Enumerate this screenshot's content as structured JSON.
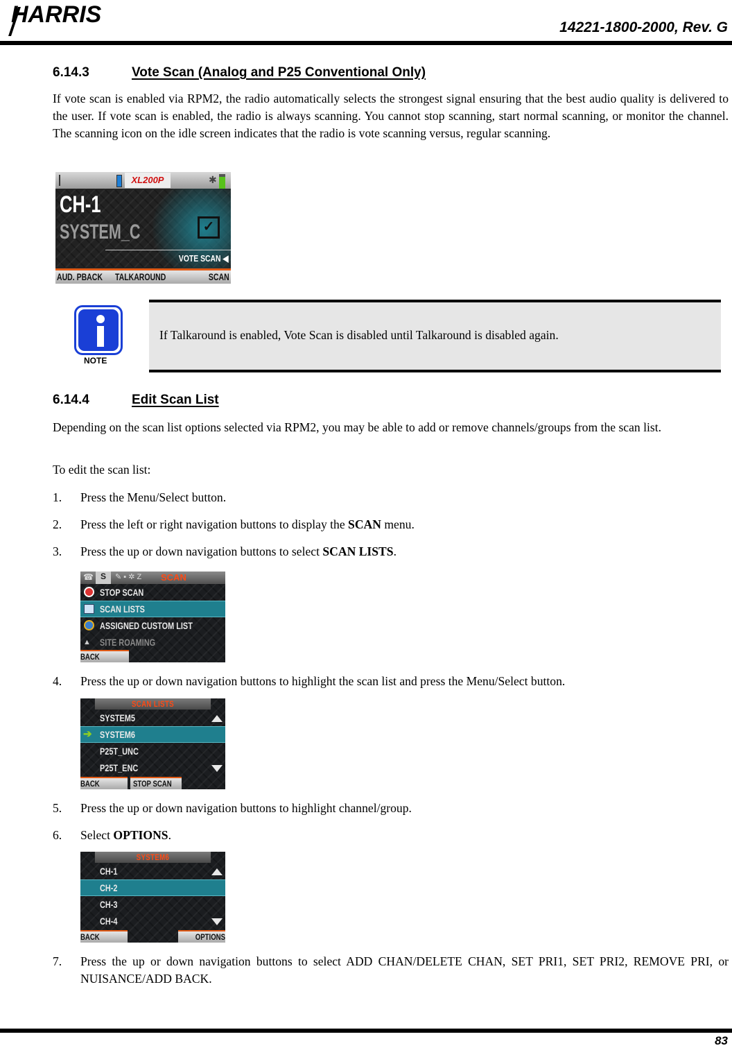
{
  "header": {
    "logo_text": "HARRIS",
    "doc_number": "14221-1800-2000, Rev. G"
  },
  "section_1": {
    "number": "6.14.3",
    "title": "Vote Scan (Analog and P25 Conventional Only)",
    "paragraph": "If vote scan is enabled via RPM2, the radio automatically selects the strongest signal ensuring that the best audio quality is delivered to the user. If vote scan is enabled, the radio is always scanning. You cannot stop scanning, start normal scanning, or monitor the channel. The scanning icon on the idle screen indicates that the radio is vote scanning versus, regular scanning.",
    "screen": {
      "brand": "XL200P",
      "channel": "CH-1",
      "system": "SYSTEM_C",
      "status": "VOTE SCAN",
      "softkeys": [
        "AUD. PBACK",
        "TALKAROUND",
        "SCAN"
      ],
      "colors": {
        "accent": "#e05a16",
        "teal": "#1f7f8e",
        "battery": "#57c21b"
      }
    }
  },
  "note": {
    "label": "NOTE",
    "text": "If Talkaround is enabled, Vote Scan is disabled until Talkaround is disabled again."
  },
  "section_2": {
    "number": "6.14.4",
    "title": "Edit Scan List",
    "paragraph": "Depending on the scan list options selected via RPM2, you may be able to add or remove channels/groups from the scan list.",
    "intro": "To edit the scan list:",
    "steps": [
      {
        "n": "1.",
        "text": "Press the Menu/Select button."
      },
      {
        "n": "2.",
        "pre": "Press the left or right navigation buttons to display the ",
        "bold": "SCAN",
        "post": " menu."
      },
      {
        "n": "3.",
        "pre": "Press the up or down navigation buttons to select ",
        "bold": "SCAN LISTS",
        "post": "."
      },
      {
        "n": "4.",
        "text": "Press the up or down navigation buttons to highlight the scan list and press the Menu/Select button."
      },
      {
        "n": "5.",
        "text": "Press the up or down navigation buttons to highlight channel/group."
      },
      {
        "n": "6.",
        "pre": "Select ",
        "bold": "OPTIONS",
        "post": "."
      },
      {
        "n": "7.",
        "text": "Press the up or down navigation buttons to select ADD CHAN/DELETE CHAN, SET PRI1, SET PRI2, REMOVE PRI, or NUISANCE/ADD BACK."
      }
    ],
    "screen_scan_menu": {
      "title": "SCAN",
      "items": [
        "STOP SCAN",
        "SCAN LISTS",
        "ASSIGNED CUSTOM LIST",
        "SITE ROAMING"
      ],
      "selected_index": 1,
      "softkey_left": "BACK"
    },
    "screen_scan_lists": {
      "title": "SCAN LISTS",
      "items": [
        "SYSTEM5",
        "SYSTEM6",
        "P25T_UNC",
        "P25T_ENC"
      ],
      "selected_index": 1,
      "softkey_left": "BACK",
      "softkey_mid": "STOP SCAN"
    },
    "screen_system6": {
      "title": "SYSTEM6",
      "items": [
        "CH-1",
        "CH-2",
        "CH-3",
        "CH-4"
      ],
      "selected_index": 1,
      "softkey_left": "BACK",
      "softkey_right": "OPTIONS"
    }
  },
  "footer": {
    "page_number": "83"
  }
}
